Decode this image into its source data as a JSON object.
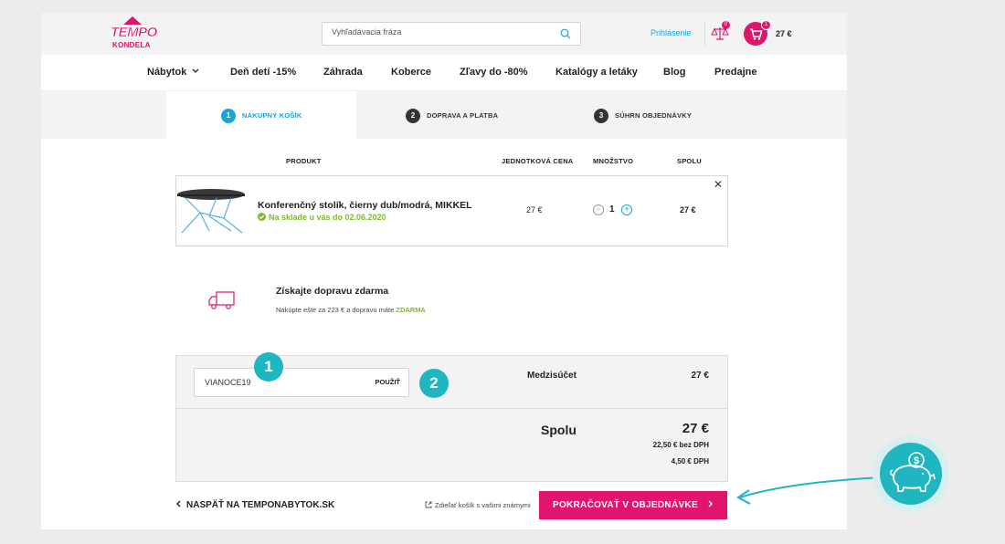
{
  "header": {
    "logo_top": "TEMPO",
    "logo_bottom": "KONDELA",
    "search_placeholder": "Vyhľadávacia fráza",
    "login": "Prihlásenie",
    "compare_count": "0",
    "cart_count": "1",
    "cart_total": "27 €"
  },
  "nav": [
    "Nábytok",
    "Deň detí -15%",
    "Záhrada",
    "Koberce",
    "Zľavy do -80%",
    "Katalógy a letáky",
    "Blog",
    "Predajne"
  ],
  "steps": [
    {
      "num": "1",
      "label": "NÁKUPNÝ KOŠÍK",
      "active": true
    },
    {
      "num": "2",
      "label": "DOPRAVA A PLATBA",
      "active": false
    },
    {
      "num": "3",
      "label": "SÚHRN OBJEDNÁVKY",
      "active": false
    }
  ],
  "table": {
    "col_product": "PRODUKT",
    "col_unit_price": "JEDNOTKOVÁ CENA",
    "col_quantity": "MNOŽSTVO",
    "col_total": "SPOLU"
  },
  "item": {
    "name": "Konferenčný stolík, čierny dub/modrá, MIKKEL",
    "stock": "Na sklade u vás do 02.06.2020",
    "unit_price": "27 €",
    "quantity": "1",
    "total": "27 €"
  },
  "shipping": {
    "title": "Získajte dopravu zdarma",
    "note_prefix": "Nakúpte ešte za 223 € a dopravu máte",
    "note_highlight": "ZDARMA"
  },
  "summary": {
    "coupon_value": "VIANOCE19",
    "apply": "POUŽIŤ",
    "subtotal_label": "Medzisúčet",
    "subtotal_value": "27 €",
    "total_label": "Spolu",
    "total_value": "27 €",
    "without_vat": "22,50 € bez DPH",
    "vat": "4,50 € DPH"
  },
  "footer": {
    "back": "NASPÄŤ NA TEMPONABYTOK.SK",
    "share": "Zdieľať košík s vašimi známymi",
    "continue": "POKRAČOVAŤ V OBJEDNÁVKE"
  },
  "annotations": [
    "1",
    "2"
  ],
  "colors": {
    "brand": "#d9176c",
    "accent": "#1aa3d9",
    "success": "#7cbb2c",
    "annotation": "#1fb6c1"
  }
}
